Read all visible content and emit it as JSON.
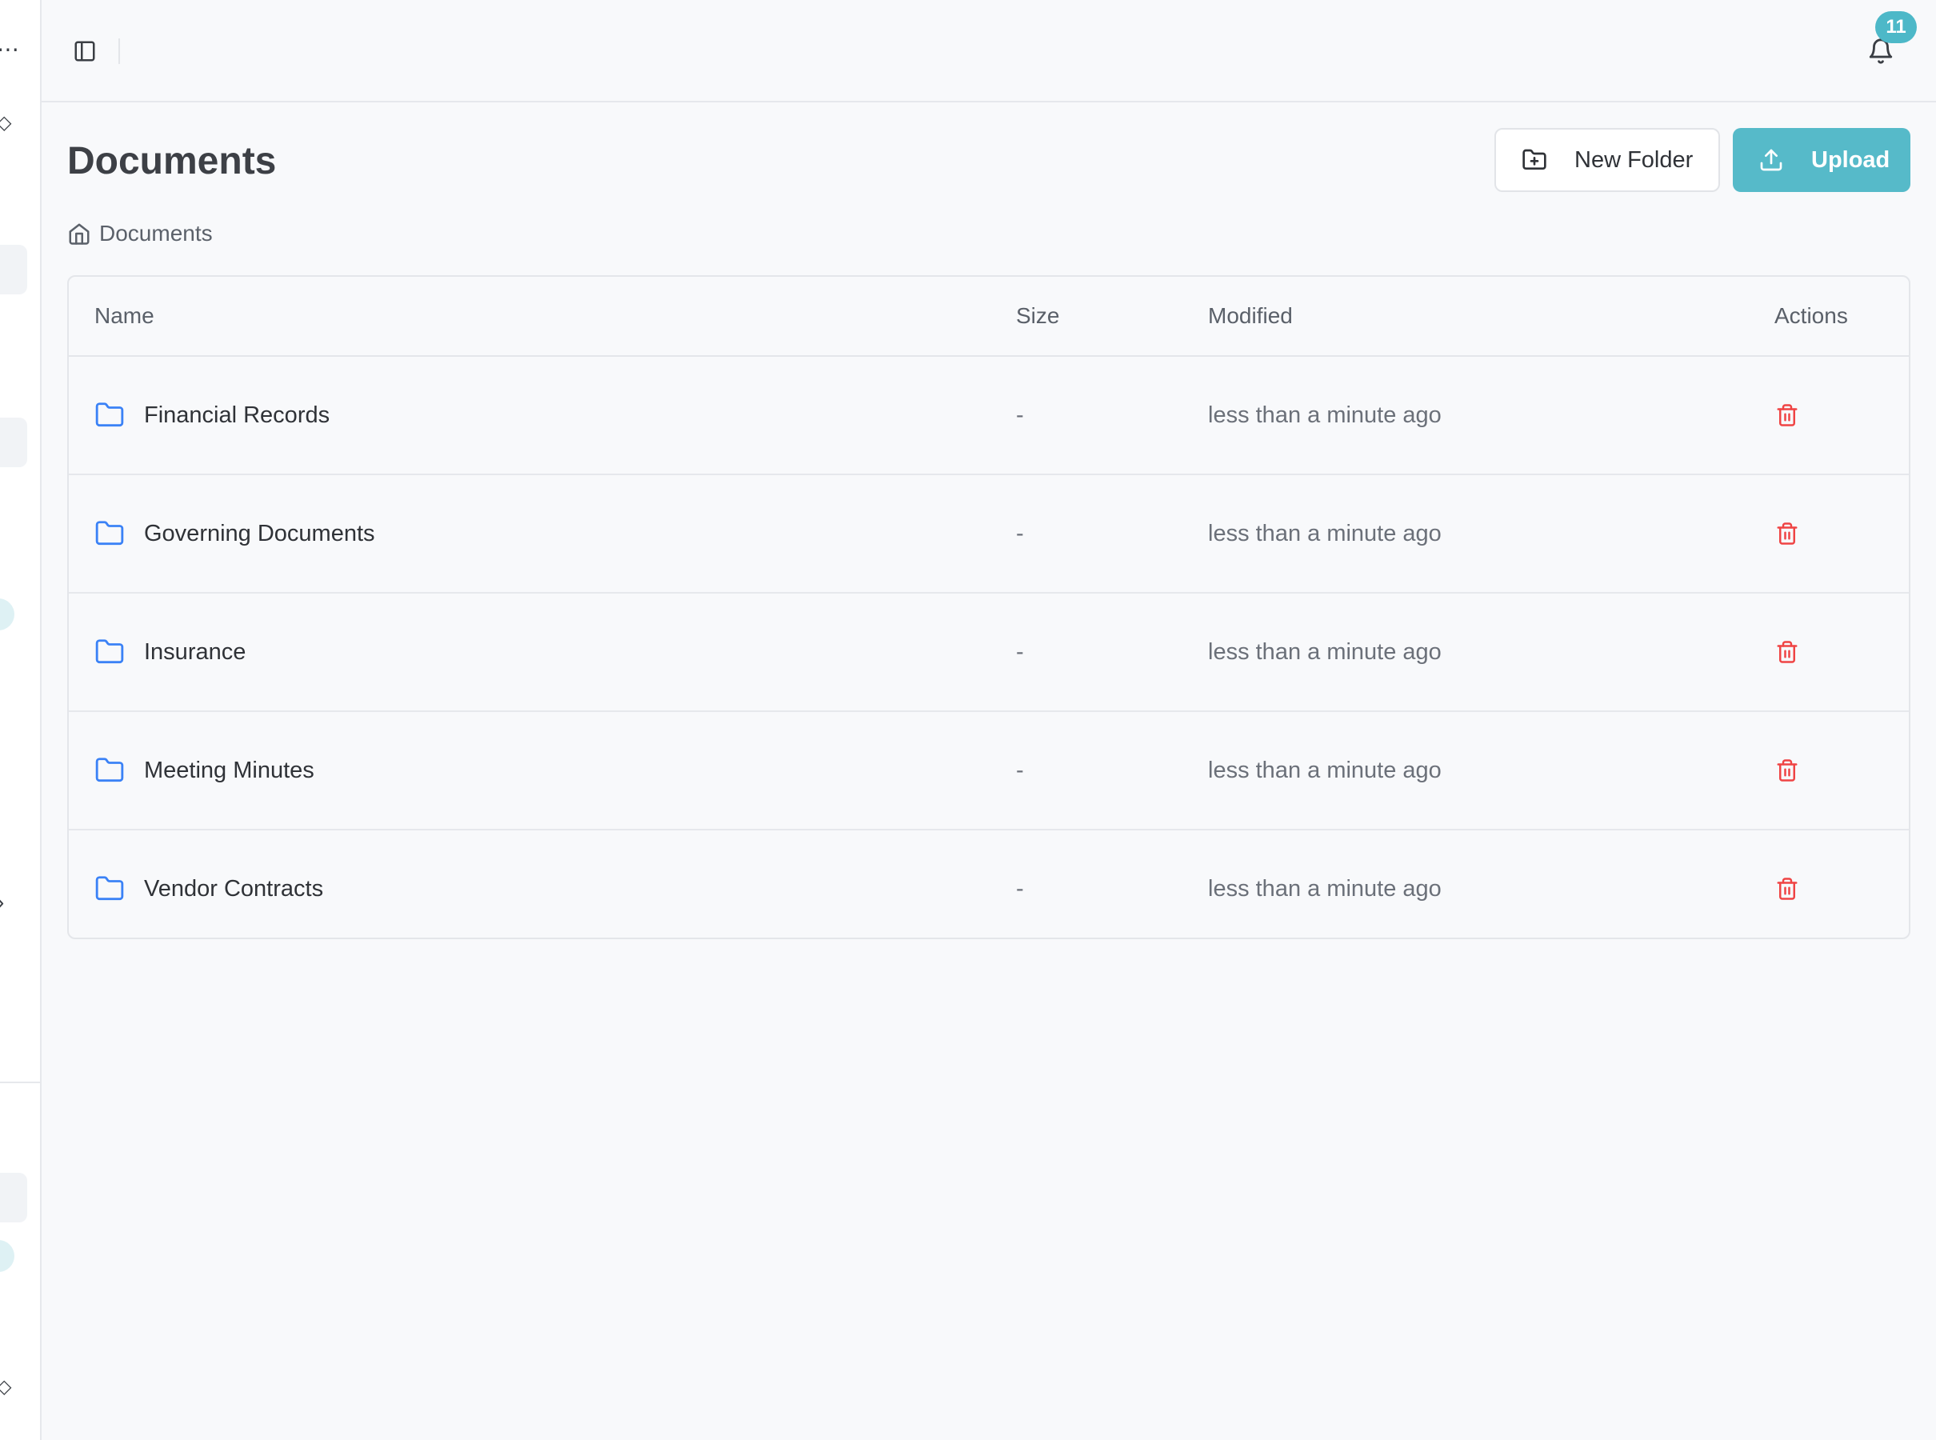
{
  "sidebar": {
    "glyphs": [
      "…",
      "⌃⌄",
      "⌃⌄",
      "›"
    ]
  },
  "topbar": {
    "notifications_count": "11"
  },
  "page": {
    "title": "Documents",
    "new_folder_label": "New Folder",
    "upload_label": "Upload"
  },
  "breadcrumb": {
    "home_label": "Documents"
  },
  "table": {
    "columns": [
      "Name",
      "Size",
      "Modified",
      "Actions"
    ],
    "rows": [
      {
        "name": "Financial Records",
        "size": "-",
        "modified": "less than a minute ago"
      },
      {
        "name": "Governing Documents",
        "size": "-",
        "modified": "less than a minute ago"
      },
      {
        "name": "Insurance",
        "size": "-",
        "modified": "less than a minute ago"
      },
      {
        "name": "Meeting Minutes",
        "size": "-",
        "modified": "less than a minute ago"
      },
      {
        "name": "Vendor Contracts",
        "size": "-",
        "modified": "less than a minute ago"
      }
    ]
  },
  "colors": {
    "accent": "#56bac9",
    "folder_icon": "#3b82f6",
    "danger": "#ef4444"
  },
  "icons": {
    "sidebar_toggle": "sidebar-toggle-icon",
    "bell": "bell-icon",
    "folder_plus": "folder-plus-icon",
    "upload": "upload-icon",
    "home": "home-icon",
    "folder": "folder-icon",
    "trash": "trash-icon"
  }
}
